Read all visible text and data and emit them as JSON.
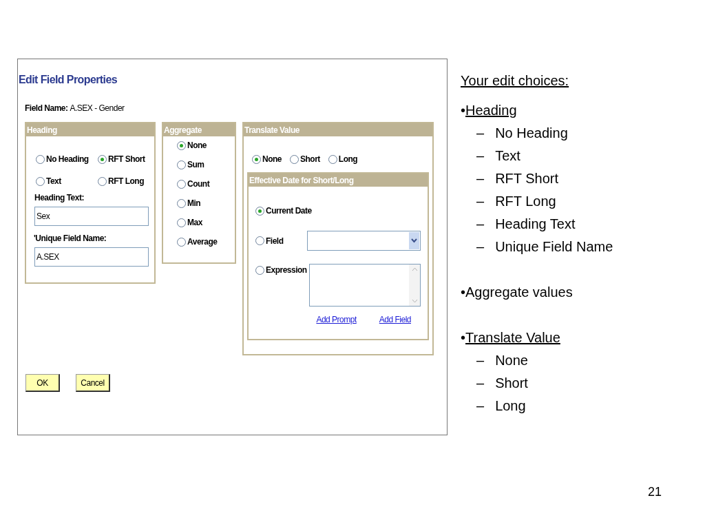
{
  "dialog": {
    "title": "Edit Field Properties",
    "field_name_label": "Field Name:",
    "field_name_value": "A.SEX - Gender",
    "heading": {
      "title": "Heading",
      "options": [
        {
          "label": "No Heading",
          "selected": false
        },
        {
          "label": "RFT Short",
          "selected": true
        },
        {
          "label": "Text",
          "selected": false
        },
        {
          "label": "RFT Long",
          "selected": false
        }
      ],
      "heading_text_label": "Heading Text:",
      "heading_text_value": "Sex",
      "unique_label": "'Unique Field Name:",
      "unique_value": "A.SEX"
    },
    "aggregate": {
      "title": "Aggregate",
      "options": [
        {
          "label": "None",
          "selected": true
        },
        {
          "label": "Sum",
          "selected": false
        },
        {
          "label": "Count",
          "selected": false
        },
        {
          "label": "Min",
          "selected": false
        },
        {
          "label": "Max",
          "selected": false
        },
        {
          "label": "Average",
          "selected": false
        }
      ]
    },
    "translate": {
      "title": "Translate Value",
      "options": [
        {
          "label": "None",
          "selected": true
        },
        {
          "label": "Short",
          "selected": false
        },
        {
          "label": "Long",
          "selected": false
        }
      ],
      "effective": {
        "title": "Effective Date for Short/Long",
        "options": [
          {
            "label": "Current Date",
            "selected": true,
            "kind": "plain"
          },
          {
            "label": "Field",
            "selected": false,
            "kind": "select"
          },
          {
            "label": "Expression",
            "selected": false,
            "kind": "textarea"
          }
        ],
        "links": [
          "Add Prompt",
          "Add Field"
        ]
      }
    },
    "buttons": [
      "OK",
      "Cancel"
    ]
  },
  "notes": {
    "title": "Your edit choices:",
    "sections": [
      {
        "marker": "•",
        "label": "Heading",
        "underlined": true,
        "items": [
          {
            "marker": "–",
            "text": "No Heading"
          },
          {
            "marker": "–",
            "text": "Text"
          },
          {
            "marker": "–",
            "text": "RFT Short"
          },
          {
            "marker": "–",
            "text": "RFT Long"
          },
          {
            "marker": "–",
            "text": "Heading Text"
          },
          {
            "marker": "–",
            "text": "Unique Field Name"
          }
        ]
      },
      {
        "marker": "•",
        "label": "Aggregate values",
        "underlined": false
      },
      {
        "marker": "•",
        "label": "Translate Value",
        "underlined": true,
        "items": [
          {
            "marker": "–",
            "text": "None"
          },
          {
            "marker": "–",
            "text": "Short"
          },
          {
            "marker": "–",
            "text": "Long"
          }
        ]
      }
    ]
  },
  "page_number": "21"
}
